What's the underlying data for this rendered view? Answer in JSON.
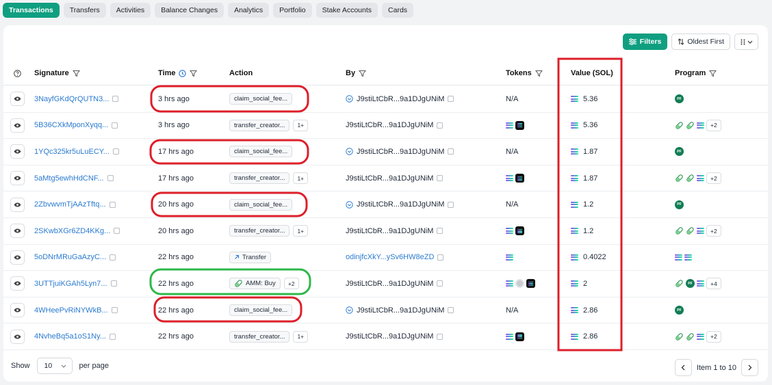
{
  "tabs": [
    "Transactions",
    "Transfers",
    "Activities",
    "Balance Changes",
    "Analytics",
    "Portfolio",
    "Stake Accounts",
    "Cards"
  ],
  "toolbar": {
    "filters_label": "Filters",
    "sort_label": "Oldest First"
  },
  "columns": {
    "signature": "Signature",
    "time": "Time",
    "action": "Action",
    "by": "By",
    "tokens": "Tokens",
    "value": "Value (SOL)",
    "program": "Program"
  },
  "rows": [
    {
      "signature": "3NayfGKdQrQUTN3...",
      "time": "3 hrs ago",
      "action": "claim_social_fee...",
      "action_more": "",
      "by": "J9stiLtCbR...9a1DJgUNiM",
      "tokens": "N/A",
      "value": "5.36"
    },
    {
      "signature": "5B36CXkMponXyqq...",
      "time": "3 hrs ago",
      "action": "transfer_creator...",
      "action_more": "1+",
      "by": "J9stiLtCbR...9a1DJgUNiM",
      "tokens": "",
      "value": "5.36",
      "program_more": "+2"
    },
    {
      "signature": "1YQc325kr5uLuECY...",
      "time": "17 hrs ago",
      "action": "claim_social_fee...",
      "action_more": "",
      "by": "J9stiLtCbR...9a1DJgUNiM",
      "tokens": "N/A",
      "value": "1.87"
    },
    {
      "signature": "5aMtg5ewhHdCNF...",
      "time": "17 hrs ago",
      "action": "transfer_creator...",
      "action_more": "1+",
      "by": "J9stiLtCbR...9a1DJgUNiM",
      "tokens": "",
      "value": "1.87",
      "program_more": "+2"
    },
    {
      "signature": "2ZbvwvmTjAAzTftq...",
      "time": "20 hrs ago",
      "action": "claim_social_fee...",
      "action_more": "",
      "by": "J9stiLtCbR...9a1DJgUNiM",
      "tokens": "N/A",
      "value": "1.2"
    },
    {
      "signature": "2SKwbXGr6ZD4KKg...",
      "time": "20 hrs ago",
      "action": "transfer_creator...",
      "action_more": "1+",
      "by": "J9stiLtCbR...9a1DJgUNiM",
      "tokens": "",
      "value": "1.2",
      "program_more": "+2"
    },
    {
      "signature": "5oDNrMRuGaAzyC...",
      "time": "22 hrs ago",
      "action": "Transfer",
      "action_more": "",
      "by": "odinjfcXkY...ySv6HW8eZD",
      "tokens": "",
      "value": "0.4022"
    },
    {
      "signature": "3UTTjuiKGAh5Lyn7...",
      "time": "22 hrs ago",
      "action": "AMM: Buy",
      "action_more": "+2",
      "by": "J9stiLtCbR...9a1DJgUNiM",
      "tokens": "",
      "value": "2",
      "program_more": "+4"
    },
    {
      "signature": "4WHeePvRiNYWkB...",
      "time": "22 hrs ago",
      "action": "claim_social_fee...",
      "action_more": "",
      "by": "J9stiLtCbR...9a1DJgUNiM",
      "tokens": "N/A",
      "value": "2.86"
    },
    {
      "signature": "4NvheBq5a1oS1Ny...",
      "time": "22 hrs ago",
      "action": "transfer_creator...",
      "action_more": "1+",
      "by": "J9stiLtCbR...9a1DJgUNiM",
      "tokens": "",
      "value": "2.86",
      "program_more": "+2"
    }
  ],
  "footer": {
    "show_label": "Show",
    "page_size": "10",
    "per_page_label": "per page",
    "range_label": "Item 1 to 10"
  },
  "colors": {
    "accent": "#0f9f80",
    "link": "#2b7bd0",
    "highlight_red": "#dd1f2a",
    "highlight_green": "#2eb84a"
  }
}
